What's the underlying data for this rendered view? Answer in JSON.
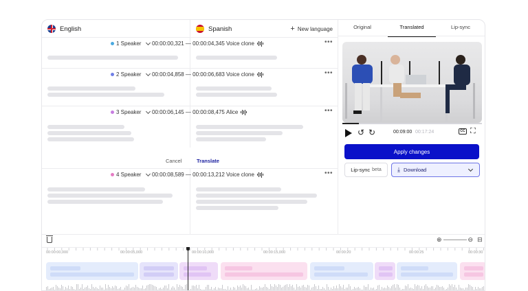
{
  "editor": {
    "source_language": "English",
    "target_language": "Spanish",
    "new_language_label": "New language",
    "segments": [
      {
        "speaker": "1 Speaker",
        "timecode": "00:00:00,321 — 00:00:04,345",
        "voice": "Voice clone",
        "color": "#4aa9e0"
      },
      {
        "speaker": "2 Speaker",
        "timecode": "00:00:04,858 — 00:00:06,683",
        "voice": "Voice clone",
        "color": "#6f7fe6"
      },
      {
        "speaker": "3 Speaker",
        "timecode": "00:00:06,145 — 00:00:08,475",
        "voice": "Alice",
        "color": "#c77de0"
      },
      {
        "speaker": "4 Speaker",
        "timecode": "00:00:08,589 — 00:00:13,212",
        "voice": "Voice clone",
        "color": "#e57cc4"
      }
    ],
    "actions": {
      "cancel": "Cancel",
      "translate": "Translate"
    }
  },
  "panel": {
    "tabs": [
      "Original",
      "Translated",
      "Lip-sync"
    ],
    "active_tab": "Translated",
    "player": {
      "current_time": "00:09:00",
      "total_time": "00:17:24",
      "progress": 0.12,
      "cc_label": "CC"
    },
    "apply_label": "Apply changes",
    "lipsync_label": "Lip-sync",
    "beta_label": "beta",
    "download_label": "Download"
  },
  "timeline": {
    "ticks": [
      "00:00:00,000",
      "00:00:05,000",
      "00:00:10,000",
      "00:00:15,000",
      "00:00:20",
      "00:00:25",
      "00:00:30"
    ]
  },
  "colors": {
    "accent": "#0a11c9",
    "download_border": "#6c73e6"
  }
}
